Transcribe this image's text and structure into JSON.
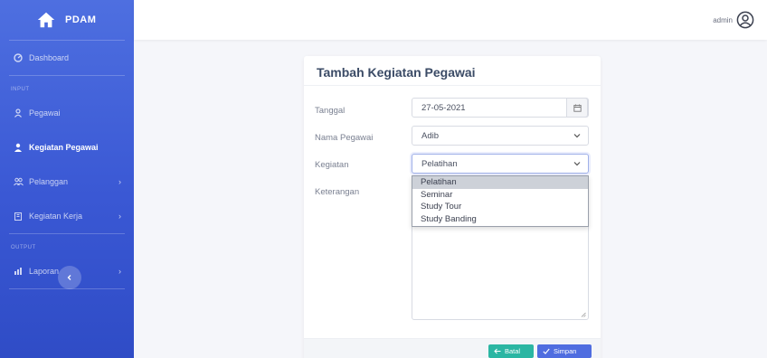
{
  "brand": {
    "name": "PDAM"
  },
  "sidebar": {
    "items": [
      {
        "label": "Dashboard"
      },
      {
        "section": "INPUT"
      },
      {
        "label": "Pegawai"
      },
      {
        "label": "Kegiatan Pegawai"
      },
      {
        "label": "Pelanggan"
      },
      {
        "label": "Kegiatan Kerja"
      },
      {
        "section": "OUTPUT"
      },
      {
        "label": "Laporan"
      }
    ]
  },
  "topbar": {
    "user": "admin"
  },
  "form": {
    "title": "Tambah Kegiatan Pegawai",
    "tanggal_label": "Tanggal",
    "tanggal_value": "27-05-2021",
    "nama_label": "Nama Pegawai",
    "nama_value": "Adib",
    "kegiatan_label": "Kegiatan",
    "kegiatan_value": "Pelatihan",
    "keterangan_label": "Keterangan",
    "kegiatan_options": [
      "Pelatihan",
      "Seminar",
      "Study Tour",
      "Study Banding"
    ],
    "batal_label": "Batal",
    "simpan_label": "Simpan"
  },
  "colors": {
    "sidebar": "#3a58d4",
    "primary": "#4f6de0",
    "teal": "#2bb6a3"
  }
}
